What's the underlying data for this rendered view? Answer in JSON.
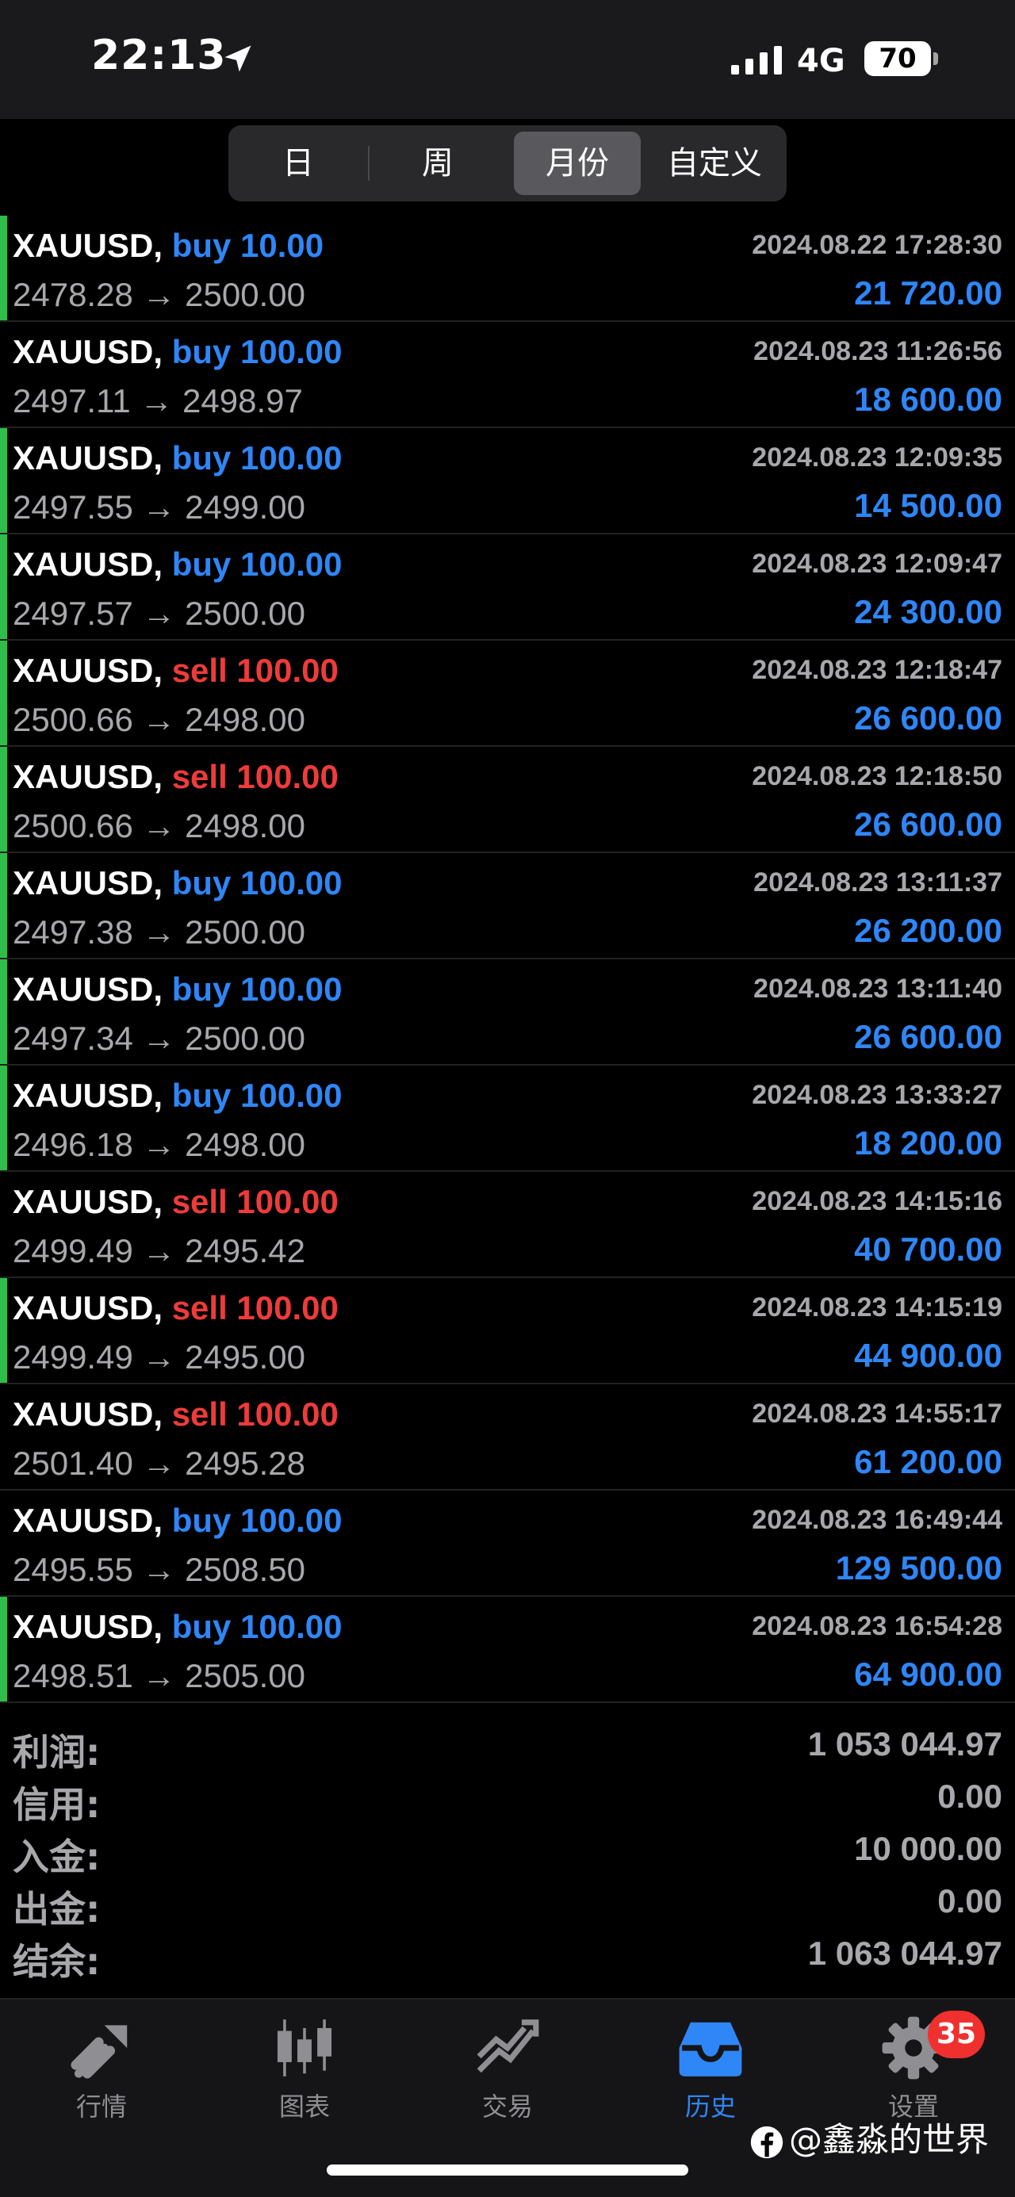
{
  "status_bar": {
    "time": "22:13",
    "network": "4G",
    "battery": "70"
  },
  "period_tabs": [
    {
      "label": "日",
      "active": false
    },
    {
      "label": "周",
      "active": false
    },
    {
      "label": "月份",
      "active": true
    },
    {
      "label": "自定义",
      "active": false
    }
  ],
  "trades": [
    {
      "symbol": "XAUUSD,",
      "side": "buy",
      "volume": "10.00",
      "side_label": "buy 10.00",
      "prices": "2478.28 → 2500.00",
      "time": "2024.08.22 17:28:30",
      "profit": "21 720.00",
      "marked": true
    },
    {
      "symbol": "XAUUSD,",
      "side": "buy",
      "volume": "100.00",
      "side_label": "buy 100.00",
      "prices": "2497.11 → 2498.97",
      "time": "2024.08.23 11:26:56",
      "profit": "18 600.00",
      "marked": false
    },
    {
      "symbol": "XAUUSD,",
      "side": "buy",
      "volume": "100.00",
      "side_label": "buy 100.00",
      "prices": "2497.55 → 2499.00",
      "time": "2024.08.23 12:09:35",
      "profit": "14 500.00",
      "marked": true
    },
    {
      "symbol": "XAUUSD,",
      "side": "buy",
      "volume": "100.00",
      "side_label": "buy 100.00",
      "prices": "2497.57 → 2500.00",
      "time": "2024.08.23 12:09:47",
      "profit": "24 300.00",
      "marked": true
    },
    {
      "symbol": "XAUUSD,",
      "side": "sell",
      "volume": "100.00",
      "side_label": "sell 100.00",
      "prices": "2500.66 → 2498.00",
      "time": "2024.08.23 12:18:47",
      "profit": "26 600.00",
      "marked": true
    },
    {
      "symbol": "XAUUSD,",
      "side": "sell",
      "volume": "100.00",
      "side_label": "sell 100.00",
      "prices": "2500.66 → 2498.00",
      "time": "2024.08.23 12:18:50",
      "profit": "26 600.00",
      "marked": true
    },
    {
      "symbol": "XAUUSD,",
      "side": "buy",
      "volume": "100.00",
      "side_label": "buy 100.00",
      "prices": "2497.38 → 2500.00",
      "time": "2024.08.23 13:11:37",
      "profit": "26 200.00",
      "marked": true
    },
    {
      "symbol": "XAUUSD,",
      "side": "buy",
      "volume": "100.00",
      "side_label": "buy 100.00",
      "prices": "2497.34 → 2500.00",
      "time": "2024.08.23 13:11:40",
      "profit": "26 600.00",
      "marked": true
    },
    {
      "symbol": "XAUUSD,",
      "side": "buy",
      "volume": "100.00",
      "side_label": "buy 100.00",
      "prices": "2496.18 → 2498.00",
      "time": "2024.08.23 13:33:27",
      "profit": "18 200.00",
      "marked": true
    },
    {
      "symbol": "XAUUSD,",
      "side": "sell",
      "volume": "100.00",
      "side_label": "sell 100.00",
      "prices": "2499.49 → 2495.42",
      "time": "2024.08.23 14:15:16",
      "profit": "40 700.00",
      "marked": false
    },
    {
      "symbol": "XAUUSD,",
      "side": "sell",
      "volume": "100.00",
      "side_label": "sell 100.00",
      "prices": "2499.49 → 2495.00",
      "time": "2024.08.23 14:15:19",
      "profit": "44 900.00",
      "marked": true
    },
    {
      "symbol": "XAUUSD,",
      "side": "sell",
      "volume": "100.00",
      "side_label": "sell 100.00",
      "prices": "2501.40 → 2495.28",
      "time": "2024.08.23 14:55:17",
      "profit": "61 200.00",
      "marked": false
    },
    {
      "symbol": "XAUUSD,",
      "side": "buy",
      "volume": "100.00",
      "side_label": "buy 100.00",
      "prices": "2495.55 → 2508.50",
      "time": "2024.08.23 16:49:44",
      "profit": "129 500.00",
      "marked": false
    },
    {
      "symbol": "XAUUSD,",
      "side": "buy",
      "volume": "100.00",
      "side_label": "buy 100.00",
      "prices": "2498.51 → 2505.00",
      "time": "2024.08.23 16:54:28",
      "profit": "64 900.00",
      "marked": true
    }
  ],
  "summary": [
    {
      "label": "利润:",
      "value": "1 053 044.97"
    },
    {
      "label": "信用:",
      "value": "0.00"
    },
    {
      "label": "入金:",
      "value": "10 000.00"
    },
    {
      "label": "出金:",
      "value": "0.00"
    },
    {
      "label": "结余:",
      "value": "1 063 044.97"
    }
  ],
  "tabbar": {
    "items": [
      {
        "label": "行情",
        "icon": "quotes-icon",
        "active": false
      },
      {
        "label": "图表",
        "icon": "candlestick-chart-icon",
        "active": false
      },
      {
        "label": "交易",
        "icon": "trade-icon",
        "active": false
      },
      {
        "label": "历史",
        "icon": "history-inbox-icon",
        "active": true
      },
      {
        "label": "设置",
        "icon": "gear-icon",
        "active": false
      }
    ],
    "settings_badge": "35"
  },
  "watermark": "@鑫淼的世界",
  "colors": {
    "buy": "#2f86f6",
    "sell": "#ee3b3b",
    "marker": "#2fbe4a",
    "badge": "#f0302f"
  }
}
